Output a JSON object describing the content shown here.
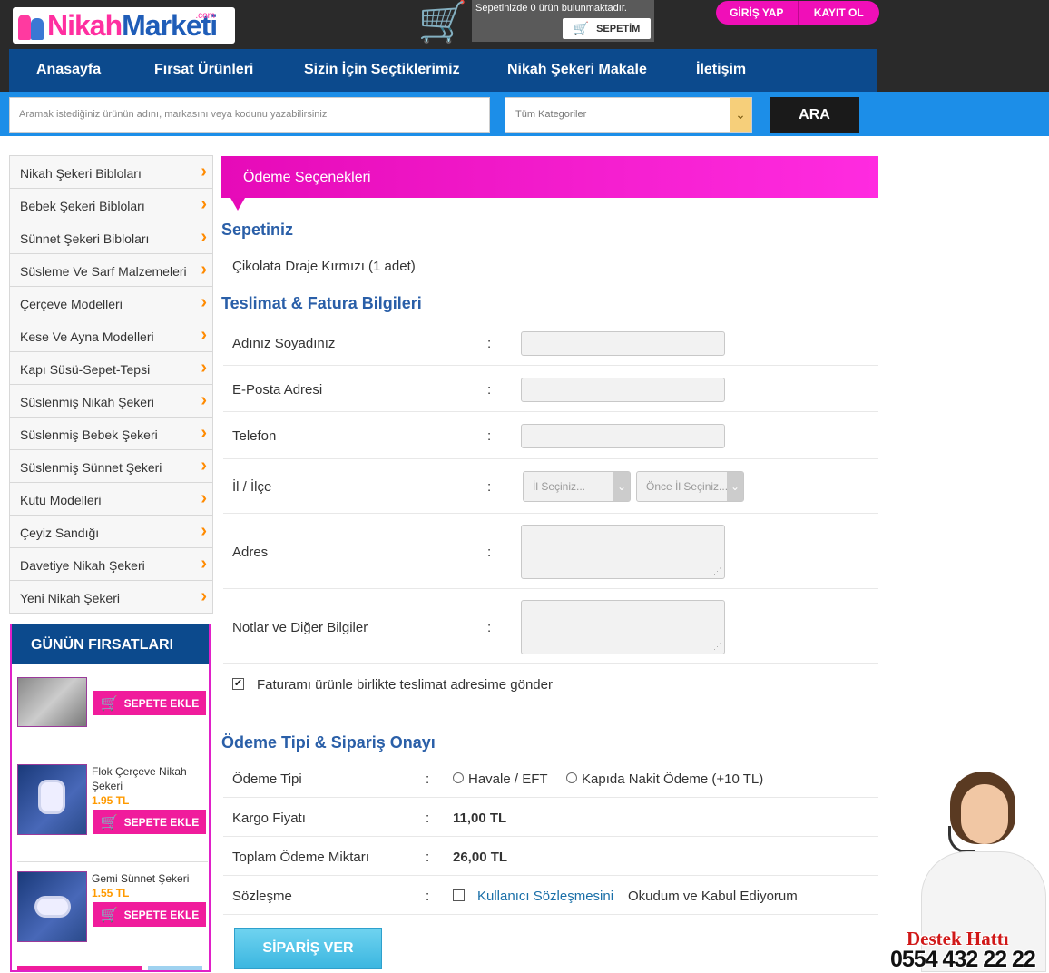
{
  "header": {
    "logo_text_a": "Nikah",
    "logo_text_b": "Marketi",
    "logo_dotcom": ".com",
    "cart_message": "Sepetinizde 0 ürün bulunmaktadır.",
    "cart_button": "SEPETİM",
    "login": "GİRİŞ YAP",
    "register": "KAYIT OL"
  },
  "nav": [
    "Anasayfa",
    "Fırsat Ürünleri",
    "Sizin İçin Seçtiklerimiz",
    "Nikah Şekeri Makale",
    "İletişim"
  ],
  "search": {
    "placeholder": "Aramak istediğiniz ürünün adını, markasını veya kodunu yazabilirsiniz",
    "category": "Tüm Kategoriler",
    "button": "ARA"
  },
  "categories": [
    "Nikah Şekeri Bibloları",
    "Bebek Şekeri Bibloları",
    "Sünnet Şekeri Bibloları",
    "Süsleme Ve Sarf Malzemeleri",
    "Çerçeve Modelleri",
    "Kese Ve Ayna Modelleri",
    "Kapı Süsü-Sepet-Tepsi",
    "Süslenmiş Nikah Şekeri",
    "Süslenmiş Bebek Şekeri",
    "Süslenmiş Sünnet Şekeri",
    "Kutu Modelleri",
    "Çeyiz Sandığı",
    "Davetiye Nikah Şekeri",
    "Yeni Nikah Şekeri"
  ],
  "deals": {
    "title": "GÜNÜN FIRSATLARI",
    "add_label": "SEPETE EKLE",
    "items": [
      {
        "name": "",
        "price": ""
      },
      {
        "name": "Flok Çerçeve Nikah Şekeri",
        "price": "1.95 TL"
      },
      {
        "name": "Gemi Sünnet Şekeri",
        "price": "1.55 TL"
      }
    ]
  },
  "main": {
    "banner": "Ödeme Seçenekleri",
    "cart_heading": "Sepetiniz",
    "cart_item": "Çikolata Draje Kırmızı (1 adet)",
    "delivery_heading": "Teslimat & Fatura Bilgileri",
    "colon": ":",
    "fields": {
      "name": "Adınız Soyadınız",
      "email": "E-Posta Adresi",
      "phone": "Telefon",
      "city": "İl / İlçe",
      "address": "Adres",
      "notes": "Notlar ve Diğer Bilgiler"
    },
    "city_select": "İl Seçiniz...",
    "district_select": "Önce İl Seçiniz...",
    "invoice_checkbox": "Faturamı ürünle birlikte teslimat adresime gönder",
    "invoice_checked": true,
    "payment_heading": "Ödeme Tipi & Sipariş Onayı",
    "payment_type_label": "Ödeme Tipi",
    "payment_option_1": "Havale / EFT",
    "payment_option_2": "Kapıda Nakit Ödeme (+10 TL)",
    "shipping_label": "Kargo Fiyatı",
    "shipping_value": "11,00 TL",
    "total_label": "Toplam Ödeme Miktarı",
    "total_value": "26,00 TL",
    "contract_label": "Sözleşme",
    "contract_link": "Kullanıcı Sözleşmesini",
    "contract_text": "Okudum ve Kabul Ediyorum",
    "submit": "SİPARİŞ VER"
  },
  "support": {
    "label": "Destek Hattı",
    "phone": "0554 432 22 22"
  },
  "colors": {
    "nav_blue": "#0c4a8d",
    "search_blue": "#1c8ee8",
    "pink": "#f01c9c",
    "heading_blue": "#2a5fa8",
    "orange": "#ff8a00"
  }
}
